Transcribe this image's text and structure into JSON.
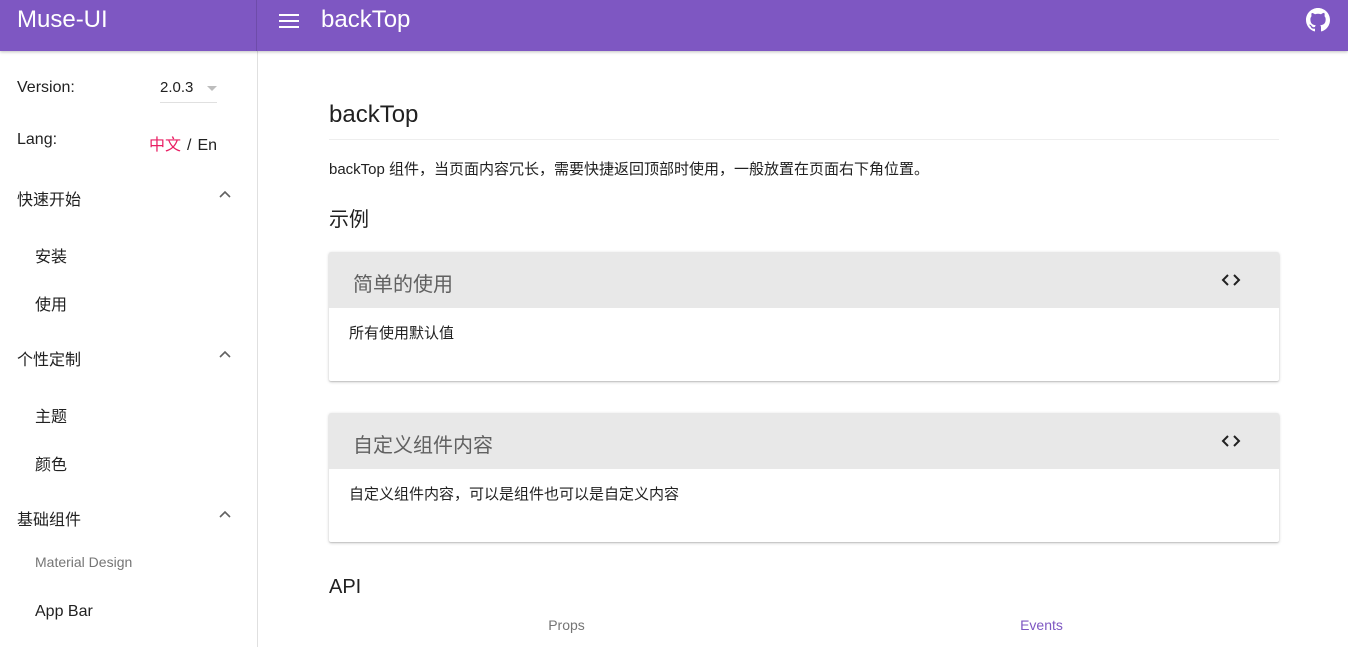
{
  "appbar": {
    "brand": "Muse-UI",
    "title": "backTop",
    "icons": {
      "menu": "menu-icon",
      "github": "github-icon"
    },
    "color": "#7e57c2"
  },
  "sidebar": {
    "version_label": "Version:",
    "version_value": "2.0.3",
    "lang_label": "Lang:",
    "lang_zh": "中文",
    "lang_sep": "/",
    "lang_en": "En",
    "groups": [
      {
        "label": "快速开始",
        "items": [
          "安装",
          "使用"
        ]
      },
      {
        "label": "个性定制",
        "items": [
          "主题",
          "颜色"
        ]
      },
      {
        "label": "基础组件",
        "subheader": "Material Design",
        "items": [
          "App Bar"
        ]
      }
    ]
  },
  "main": {
    "title": "backTop",
    "description": "backTop 组件，当页面内容冗长，需要快捷返回顶部时使用，一般放置在页面右下角位置。",
    "examples_heading": "示例",
    "demos": [
      {
        "title": "简单的使用",
        "text": "所有使用默认值",
        "icon": "code-icon"
      },
      {
        "title": "自定义组件内容",
        "text": "自定义组件内容，可以是组件也可以是自定义内容",
        "icon": "code-icon"
      }
    ],
    "api_heading": "API",
    "api_tabs": [
      "Props",
      "Events"
    ]
  },
  "colors": {
    "accent": "#e91e63",
    "card_header": "#e8e8e8"
  }
}
